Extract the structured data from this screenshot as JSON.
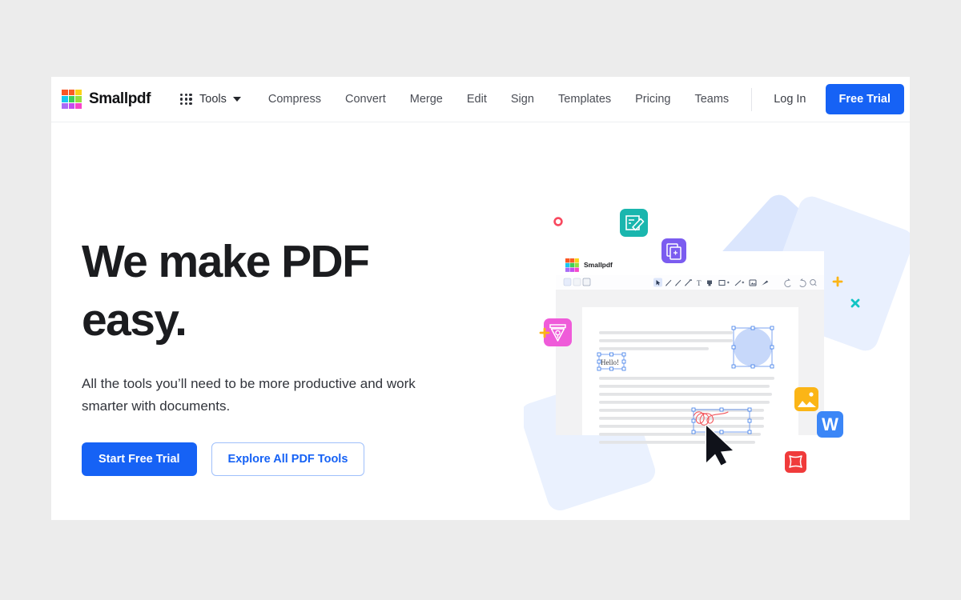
{
  "brand": {
    "name": "Smallpdf",
    "logo_icon": "smallpdf-logo-grid",
    "logo_colors": [
      "#fb5724",
      "#fb5d25",
      "#fcd216",
      "#18c8ef",
      "#3dd05a",
      "#93e03f",
      "#a96cf5",
      "#c44df0",
      "#f845c8"
    ]
  },
  "header": {
    "tools": {
      "label": "Tools",
      "icon": "apps-grid-icon",
      "caret_icon": "chevron-down-icon"
    },
    "nav_left": [
      "Compress",
      "Convert",
      "Merge",
      "Edit",
      "Sign"
    ],
    "nav_right": [
      "Templates",
      "Pricing",
      "Teams"
    ],
    "login_label": "Log In",
    "trial_label": "Free Trial",
    "accent_color": "#1662f5"
  },
  "hero": {
    "title_line1": "We make PDF",
    "title_line2": "easy.",
    "subtitle": "All the tools you’ll need to be more productive and work smarter with documents.",
    "primary_button": "Start Free Trial",
    "secondary_button": "Explore All PDF Tools"
  },
  "illustration": {
    "window_title": "Smallpdf",
    "window_logo_icon": "smallpdf-logo-grid",
    "toolbar_left_icons": [
      "page-layout-icon",
      "page-thumbnails-icon",
      "side-panel-icon"
    ],
    "toolbar_center_icons": [
      "cursor-select-icon",
      "pen-icon",
      "pencil-icon",
      "marker-icon",
      "text-icon",
      "stamp-icon",
      "shape-rect-icon",
      "line-arrow-icon",
      "image-icon",
      "eraser-icon"
    ],
    "toolbar_right_icons": [
      "undo-icon",
      "redo-icon",
      "zoom-search-icon"
    ],
    "document_annotation_text": "Hello!",
    "document_objects": [
      "text-box-hello",
      "ellipse-shape",
      "signature-scribble"
    ],
    "cursor_icon": "mouse-pointer-icon",
    "floating_badges": [
      {
        "name": "edit-document-badge",
        "color": "#1ab6ae"
      },
      {
        "name": "duplicate-pages-badge",
        "color": "#7b5cf0"
      },
      {
        "name": "sign-pen-nib-badge",
        "color": "#ef5bd9"
      },
      {
        "name": "image-photo-badge",
        "color": "#fbb516"
      },
      {
        "name": "word-doc-badge",
        "color": "#3b86f7",
        "letter": "W"
      },
      {
        "name": "crop-badge",
        "color": "#f03b3b"
      }
    ],
    "confetti": [
      {
        "name": "circle-red",
        "color": "#f8485e"
      },
      {
        "name": "plus-yellow",
        "color": "#fbb516"
      },
      {
        "name": "plus-yellow-2",
        "color": "#fbb516"
      },
      {
        "name": "cross-teal",
        "color": "#11c4c4"
      },
      {
        "name": "cross-red",
        "color": "#f8485e"
      },
      {
        "name": "circle-teal",
        "color": "#0fc2bf"
      }
    ],
    "backdrop_color": "#dbe6fd"
  }
}
